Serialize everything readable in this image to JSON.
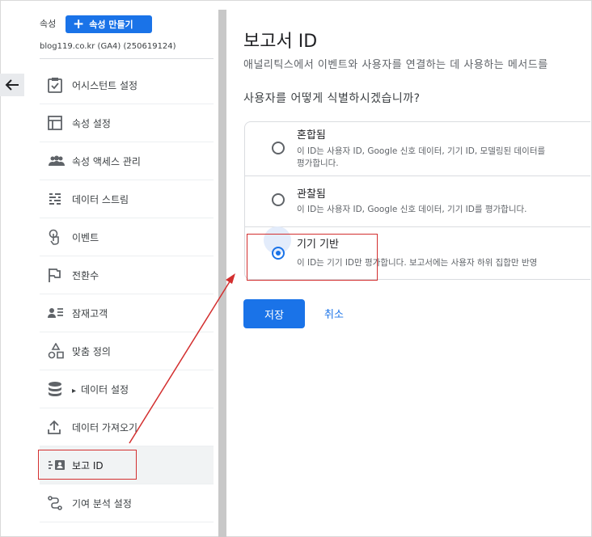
{
  "header": {
    "property_label": "속성",
    "create_button": "속성 만들기",
    "property_name": "blog119.co.kr (GA4) (250619124)"
  },
  "sidebar": {
    "items": [
      {
        "label": "어시스턴트 설정",
        "icon": "checklist-icon"
      },
      {
        "label": "속성 설정",
        "icon": "layout-icon"
      },
      {
        "label": "속성 액세스 관리",
        "icon": "people-icon"
      },
      {
        "label": "데이터 스트림",
        "icon": "stream-icon"
      },
      {
        "label": "이벤트",
        "icon": "touch-icon"
      },
      {
        "label": "전환수",
        "icon": "flag-icon"
      },
      {
        "label": "잠재고객",
        "icon": "audience-icon"
      },
      {
        "label": "맞춤 정의",
        "icon": "shapes-icon"
      },
      {
        "label": "데이터 설정",
        "icon": "database-icon",
        "expander": "▸"
      },
      {
        "label": "데이터 가져오기",
        "icon": "upload-icon"
      },
      {
        "label": "보고 ID",
        "icon": "reporting-id-icon",
        "active": true
      },
      {
        "label": "기여 분석 설정",
        "icon": "attribution-icon"
      }
    ]
  },
  "main": {
    "title": "보고서 ID",
    "subtitle": "애널리틱스에서 이벤트와 사용자를 연결하는 데 사용하는 메서드를 ",
    "question": "사용자를 어떻게 식별하시겠습니까?",
    "options": [
      {
        "name": "혼합됨",
        "desc_line1": "이 ID는 사용자 ID, Google 신호 데이터, 기기 ID, 모델링된 데이터를",
        "desc_line2": "평가합니다.",
        "selected": false
      },
      {
        "name": "관찰됨",
        "desc_line1": "이 ID는 사용자 ID, Google 신호 데이터, 기기 ID를 평가합니다.",
        "desc_line2": "",
        "selected": false
      },
      {
        "name": "기기 기반",
        "desc_line1": "이 ID는 기기 ID만 평가합니다. 보고서에는 사용자 하위 집합만 반영",
        "desc_line2": "",
        "selected": true
      }
    ],
    "save_label": "저장",
    "cancel_label": "취소"
  },
  "colors": {
    "accent": "#1a73e8",
    "highlight": "#d32f2f"
  }
}
